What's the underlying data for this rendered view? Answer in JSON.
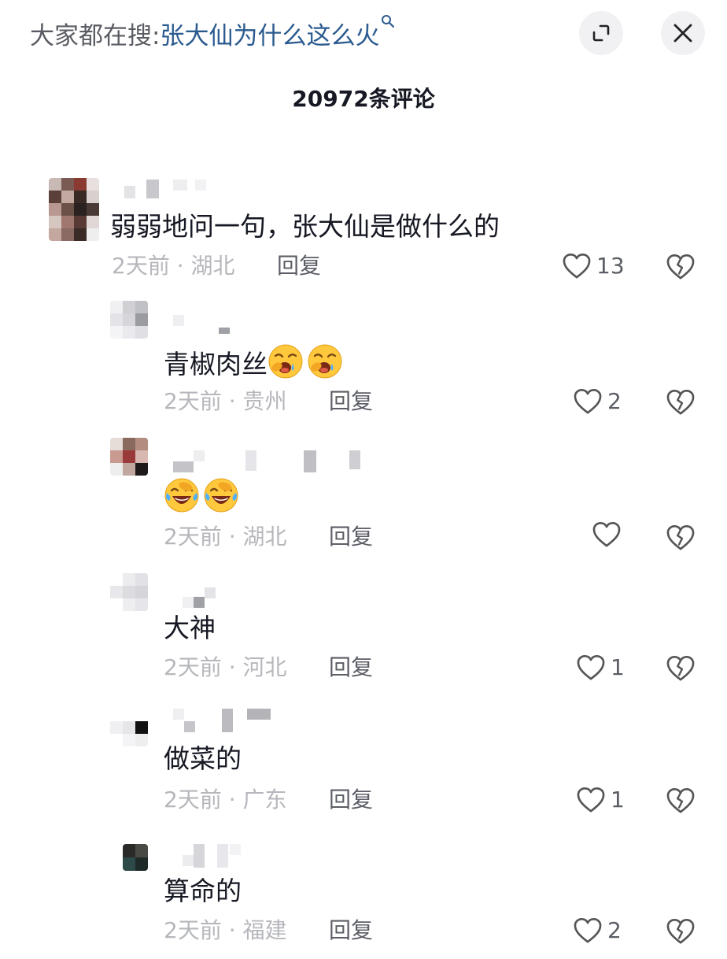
{
  "header": {
    "search_prefix": "大家都在搜:",
    "search_query": "张大仙为什么这么火",
    "icons": {
      "search": "search-icon",
      "expand": "expand-icon",
      "close": "close-icon"
    }
  },
  "comment_count": "20972条评论",
  "colors": {
    "link": "#2a5a8f",
    "meta": "#b6b7bc",
    "text": "#161823",
    "button_bg": "#f1f1f3"
  },
  "comments": [
    {
      "text": "弱弱地问一句，张大仙是做什么的",
      "meta": "2天前 · 湖北",
      "reply": "回复",
      "likes": "13"
    },
    {
      "text": "青椒肉丝",
      "emojis": [
        "crying-yawn-emoji",
        "crying-yawn-emoji"
      ],
      "meta": "2天前 · 贵州",
      "reply": "回复",
      "likes": "2"
    },
    {
      "text": "",
      "emojis": [
        "laughing-tears-emoji",
        "laughing-tears-emoji"
      ],
      "meta": "2天前 · 湖北",
      "reply": "回复",
      "likes": ""
    },
    {
      "text": "大神",
      "meta": "2天前 · 河北",
      "reply": "回复",
      "likes": "1"
    },
    {
      "text": "做菜的",
      "meta": "2天前 · 广东",
      "reply": "回复",
      "likes": "1"
    },
    {
      "text": "算命的",
      "meta": "2天前 · 福建",
      "reply": "回复",
      "likes": "2"
    }
  ]
}
